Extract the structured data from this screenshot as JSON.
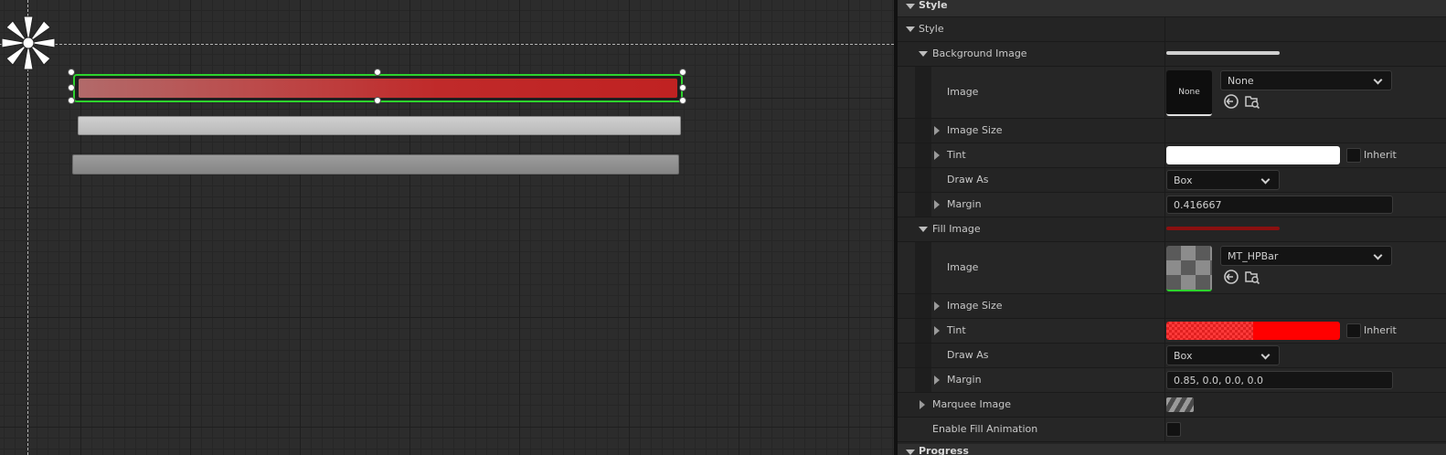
{
  "panel": {
    "header": "Style",
    "style_section": "Style",
    "background_image": {
      "label": "Background Image",
      "image_label": "Image",
      "thumbnail_text": "None",
      "asset_value": "None",
      "image_size_label": "Image Size",
      "tint_label": "Tint",
      "tint_color": "#ffffff",
      "inherit_label": "Inherit",
      "draw_as_label": "Draw As",
      "draw_as_value": "Box",
      "margin_label": "Margin",
      "margin_value": "0.416667",
      "preview_color": "#d0d0d0"
    },
    "fill_image": {
      "label": "Fill Image",
      "image_label": "Image",
      "asset_value": "MT_HPBar",
      "image_size_label": "Image Size",
      "tint_label": "Tint",
      "tint_color": "#ff0000",
      "inherit_label": "Inherit",
      "draw_as_label": "Draw As",
      "draw_as_value": "Box",
      "margin_label": "Margin",
      "margin_value": "0.85, 0.0, 0.0, 0.0",
      "preview_color": "#8a1010"
    },
    "marquee_image_label": "Marquee Image",
    "enable_fill_animation_label": "Enable Fill Animation",
    "next_section": "Progress"
  },
  "colors": {
    "selection_outline": "#2dd32d",
    "panel_bg": "#242424",
    "viewport_bg": "#2c2c2c"
  }
}
